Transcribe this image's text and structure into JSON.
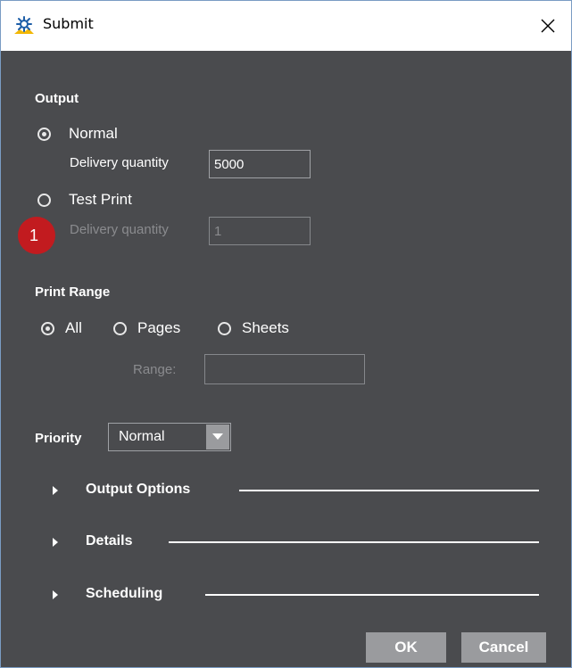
{
  "window": {
    "title": "Submit",
    "icon": "submit-app-icon",
    "close_icon": "close-icon"
  },
  "output": {
    "heading": "Output",
    "normal_label": "Normal",
    "normal_selected": true,
    "normal_delivery_label": "Delivery quantity",
    "normal_delivery_value": "5000",
    "test_print_label": "Test Print",
    "test_print_selected": false,
    "test_delivery_label": "Delivery quantity",
    "test_delivery_value": "1",
    "badge": "1"
  },
  "print_range": {
    "heading": "Print Range",
    "options": [
      {
        "label": "All",
        "selected": true
      },
      {
        "label": "Pages",
        "selected": false
      },
      {
        "label": "Sheets",
        "selected": false
      }
    ],
    "range_label": "Range:",
    "range_value": ""
  },
  "priority": {
    "label": "Priority",
    "value": "Normal"
  },
  "sections": [
    {
      "label": "Output Options",
      "expanded": false
    },
    {
      "label": "Details",
      "expanded": false
    },
    {
      "label": "Scheduling",
      "expanded": false
    }
  ],
  "buttons": {
    "ok": "OK",
    "cancel": "Cancel"
  },
  "colors": {
    "background": "#4a4b4e",
    "badge": "#c21b1f",
    "button": "#9a9b9e"
  }
}
